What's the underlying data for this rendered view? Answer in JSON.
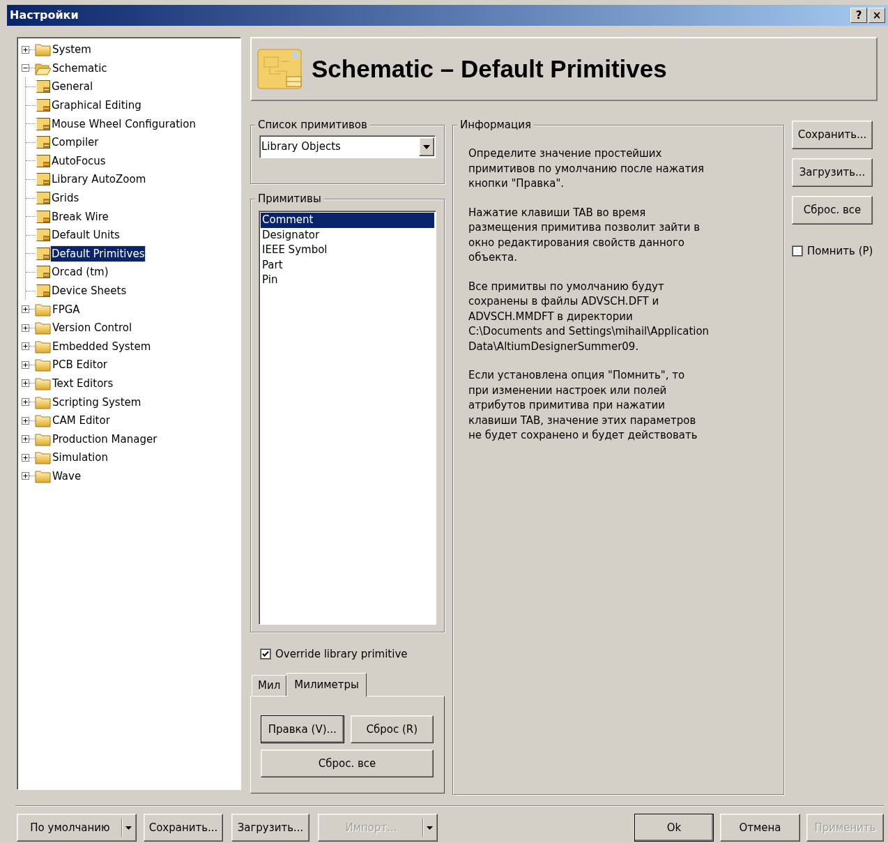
{
  "window": {
    "title": "Настройки",
    "help_button": "?",
    "close_button": "×"
  },
  "tree": [
    {
      "label": "System",
      "expanded": false,
      "selected": false
    },
    {
      "label": "Schematic",
      "expanded": true,
      "selected": false,
      "children": [
        {
          "label": "General",
          "selected": false
        },
        {
          "label": "Graphical Editing",
          "selected": false
        },
        {
          "label": "Mouse Wheel Configuration",
          "selected": false
        },
        {
          "label": "Compiler",
          "selected": false
        },
        {
          "label": "AutoFocus",
          "selected": false
        },
        {
          "label": "Library AutoZoom",
          "selected": false
        },
        {
          "label": "Grids",
          "selected": false
        },
        {
          "label": "Break Wire",
          "selected": false
        },
        {
          "label": "Default Units",
          "selected": false
        },
        {
          "label": "Default Primitives",
          "selected": true
        },
        {
          "label": "Orcad (tm)",
          "selected": false
        },
        {
          "label": "Device Sheets",
          "selected": false
        }
      ]
    },
    {
      "label": "FPGA",
      "expanded": false,
      "selected": false
    },
    {
      "label": "Version Control",
      "expanded": false,
      "selected": false
    },
    {
      "label": "Embedded System",
      "expanded": false,
      "selected": false
    },
    {
      "label": "PCB Editor",
      "expanded": false,
      "selected": false
    },
    {
      "label": "Text Editors",
      "expanded": false,
      "selected": false
    },
    {
      "label": "Scripting System",
      "expanded": false,
      "selected": false
    },
    {
      "label": "CAM Editor",
      "expanded": false,
      "selected": false
    },
    {
      "label": "Production Manager",
      "expanded": false,
      "selected": false
    },
    {
      "label": "Simulation",
      "expanded": false,
      "selected": false
    },
    {
      "label": "Wave",
      "expanded": false,
      "selected": false
    }
  ],
  "header": {
    "title": "Schematic – Default Primitives"
  },
  "primitive_list": {
    "legend": "Список примитивов",
    "value": "Library Objects"
  },
  "primitives": {
    "legend": "Примитивы",
    "items": [
      {
        "label": "Comment",
        "selected": true
      },
      {
        "label": "Designator",
        "selected": false
      },
      {
        "label": "IEEE Symbol",
        "selected": false
      },
      {
        "label": "Part",
        "selected": false
      },
      {
        "label": "Pin",
        "selected": false
      }
    ]
  },
  "override": {
    "label": "Override library primitive",
    "checked": true
  },
  "unit_tabs": [
    {
      "label": "Мил",
      "selected": false
    },
    {
      "label": "Милиметры",
      "selected": true
    }
  ],
  "tab_buttons": [
    {
      "label": "Правка (V)...",
      "default": true
    },
    {
      "label": "Сброс (R)",
      "default": false
    },
    {
      "label": "Сброс. все",
      "default": false
    }
  ],
  "info": {
    "legend": "Информация",
    "paragraphs": [
      "Определите значение простейших\nпримитивов по умолчанию после нажатия\nкнопки \"Правка\".",
      "Нажатие клавиши TAB во время\nразмещения примитива позволит зайти в\nокно редактирования свойств данного\nобъекта.",
      "Все примитвы по умолчанию будут\nсохранены в файлы ADVSCH.DFT и\nADVSCH.MMDFT в директории\nC:\\Documents and Settings\\mihail\\Application\nData\\AltiumDesignerSummer09.",
      "Если установлена опция \"Помнить\", то\nпри изменении настроек или полей\nатрибутов примитива при нажатии\nклавиши TAB, значение этих параметров\nне будет сохранено и будет действовать"
    ]
  },
  "side_buttons": [
    "Сохранить...",
    "Загрузить...",
    "Сброс. все"
  ],
  "remember": {
    "label": "Помнить (P)",
    "checked": false
  },
  "footer_buttons": [
    {
      "label": "По умолчанию",
      "dropdown": true,
      "disabled": false,
      "default": false
    },
    {
      "label": "Сохранить...",
      "dropdown": false,
      "disabled": false,
      "default": false
    },
    {
      "label": "Загрузить...",
      "dropdown": false,
      "disabled": false,
      "default": false
    },
    {
      "label": "Импорт...",
      "dropdown": true,
      "disabled": true,
      "default": false
    },
    {
      "label": "Ok",
      "dropdown": false,
      "disabled": false,
      "default": true
    },
    {
      "label": "Отмена",
      "dropdown": false,
      "disabled": false,
      "default": false
    },
    {
      "label": "Применить",
      "dropdown": false,
      "disabled": true,
      "default": false
    }
  ]
}
